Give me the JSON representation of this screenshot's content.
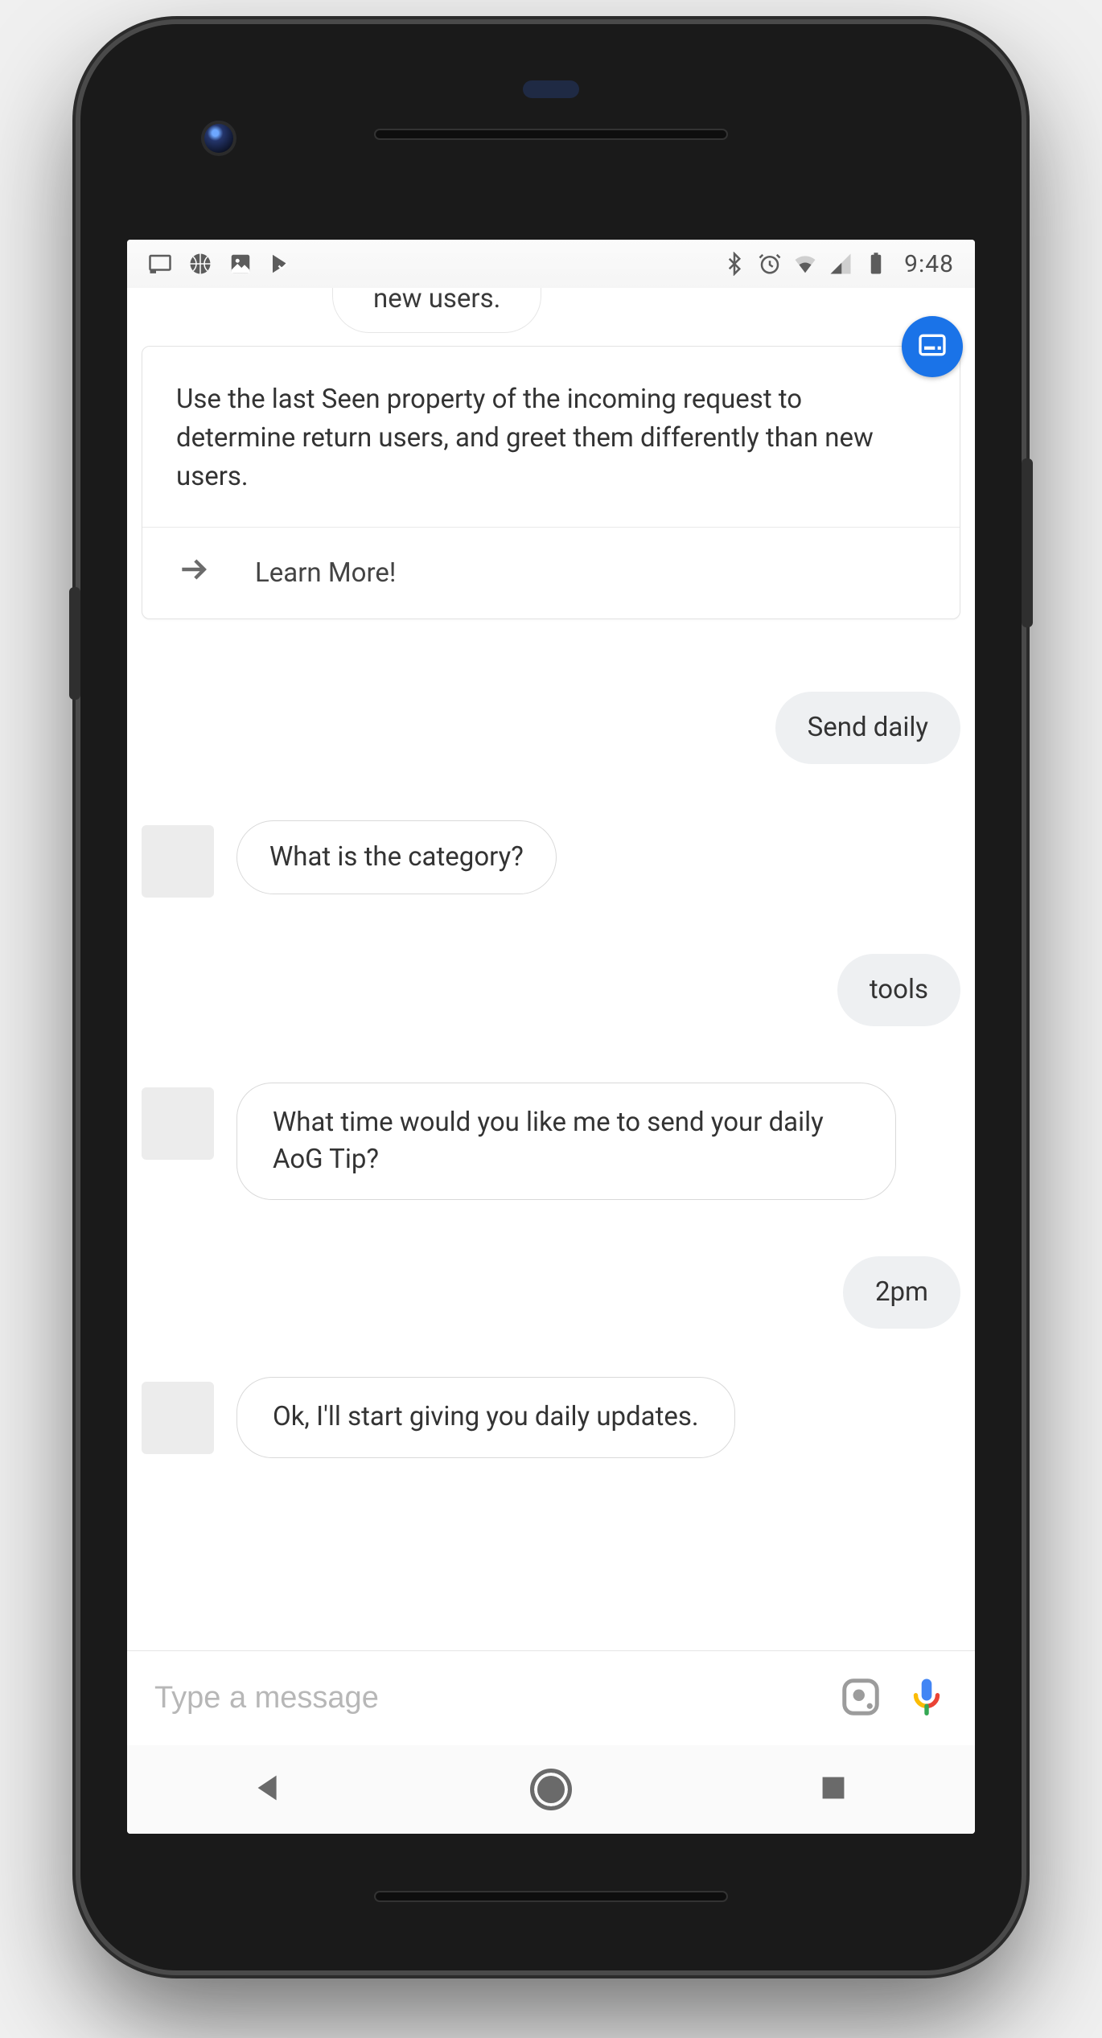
{
  "status": {
    "time": "9:48"
  },
  "card": {
    "peek_text": "new users.",
    "body": "Use the last Seen property of the incoming request to determine return users, and greet them differently than new users.",
    "action_label": "Learn More!"
  },
  "messages": {
    "user1": "Send daily",
    "bot1": "What is the category?",
    "user2": "tools",
    "bot2": "What time would you like me to send your daily AoG Tip?",
    "user3": "2pm",
    "bot3": "Ok, I'll start giving you daily updates."
  },
  "input": {
    "placeholder": "Type a message"
  },
  "colors": {
    "accent_blue": "#1a73e8",
    "bubble_user_bg": "#eef0f2",
    "text": "#333333"
  },
  "icons": {
    "status_left": [
      "cast-icon",
      "basketball-icon",
      "image-icon",
      "playstore-check-icon"
    ],
    "status_right": [
      "bluetooth-icon",
      "alarm-icon",
      "wifi-icon",
      "cell-signal-icon",
      "battery-icon"
    ],
    "card_badge": "subtitles-icon",
    "card_action_arrow": "arrow-right-icon",
    "input_lens": "lens-icon",
    "input_mic": "mic-icon",
    "nav": [
      "back-icon",
      "home-icon",
      "recents-icon"
    ]
  }
}
